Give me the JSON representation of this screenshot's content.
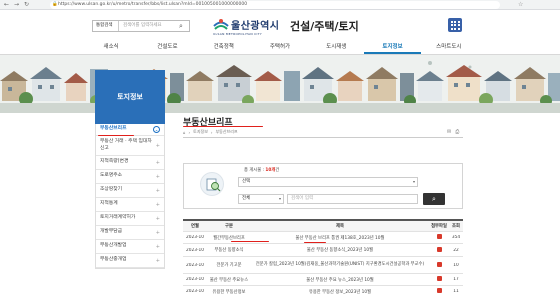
{
  "browser": {
    "url": "https://www.ulsan.go.kr/u/metro/transfer/bbs/list.ulsan?mId=001005001000000000"
  },
  "header": {
    "search": {
      "select_label": "통합검색",
      "placeholder": "검색어를 입력하세요"
    },
    "logo": {
      "name": "울산광역시",
      "english": "ULSAN METROPOLITAN CITY"
    },
    "site_title": "건설/주택/토지"
  },
  "gnb": [
    "새소식",
    "건설도로",
    "건축정책",
    "주택허가",
    "도시재생",
    "토지정보",
    "스마트도시"
  ],
  "gnb_active_index": 5,
  "sidebar": {
    "title": "토지정보",
    "items": [
      {
        "label": "부동산브리프",
        "active": true
      },
      {
        "label": "부동산 거래 · 주택 임대차 신고",
        "active": false
      },
      {
        "label": "지적측량(변경",
        "active": false
      },
      {
        "label": "도로명주소",
        "active": false
      },
      {
        "label": "조상땅찾기",
        "active": false
      },
      {
        "label": "지적통계",
        "active": false
      },
      {
        "label": "토지거래계약허가",
        "active": false
      },
      {
        "label": "개발부담금",
        "active": false
      },
      {
        "label": "부동산개발업",
        "active": false
      },
      {
        "label": "부동산중개업",
        "active": false
      }
    ]
  },
  "content": {
    "title": "부동산브리프",
    "breadcrumb": [
      "⌂",
      "토지정보",
      "부동산브리프"
    ],
    "count_prefix": "총 게시물 : ",
    "count_value": "10개",
    "count_suffix": "건",
    "filter_select": "선택",
    "field_select": "전체",
    "keyword_placeholder": "검색어 입력",
    "table": {
      "headers": [
        "연월",
        "구분",
        "제목",
        "첨부파일",
        "조회"
      ],
      "rows": [
        {
          "date": "2023-10",
          "category": "월간부동산브리프",
          "title": "울산 부동산 브리프 통권 제138호_2023년 10월",
          "attachment": true,
          "views": "354"
        },
        {
          "date": "2023-10",
          "category": "부동산 동향소식",
          "title": "울산 부동산 동향소식_2023년 10월",
          "attachment": true,
          "views": "22"
        },
        {
          "date": "2023-10",
          "category": "전문가 기고문",
          "title": "전문가 칼럼_2023년 10월(김재웅_울산과학기술원(UNIST) 지구환경도시건설공학과 부교수)",
          "attachment": true,
          "views": "10"
        },
        {
          "date": "2023-10",
          "category": "울산 부동산 주요뉴스",
          "title": "울산 부동산 주요 뉴스_2023년 10월",
          "attachment": true,
          "views": "17"
        },
        {
          "date": "2023-10",
          "category": "유용한 부동산정보",
          "title": "유용한 부동산 정보_2023년 10월",
          "attachment": true,
          "views": "11"
        }
      ]
    }
  },
  "colors": {
    "brand_blue": "#2a6fb8",
    "accent": "#1a7ab8",
    "annotation_red": "#e0201c"
  }
}
